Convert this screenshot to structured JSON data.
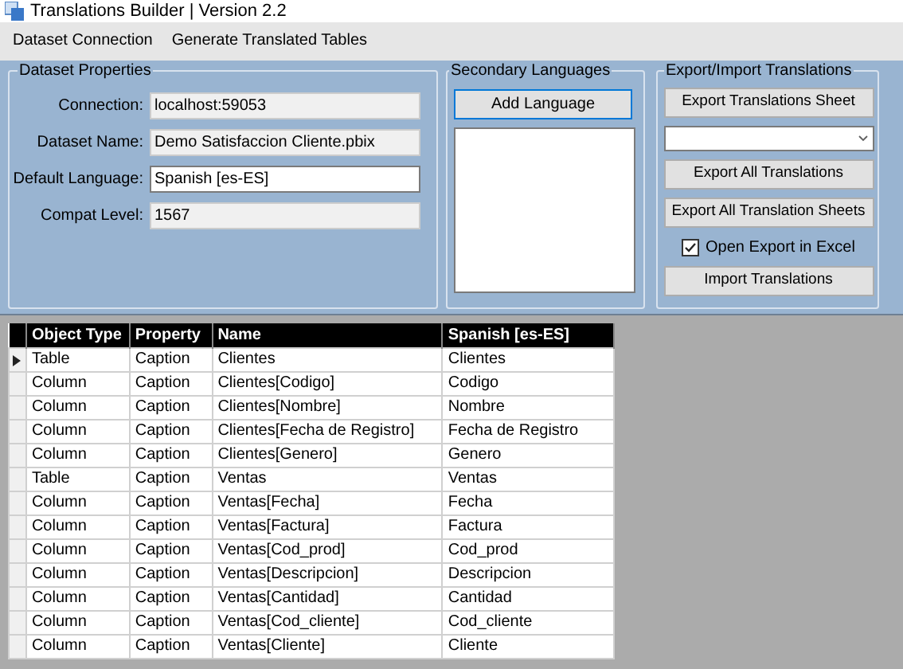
{
  "window": {
    "title": "Translations Builder | Version 2.2"
  },
  "menu": [
    "Dataset Connection",
    "Generate Translated Tables"
  ],
  "dataset_properties": {
    "title": "Dataset Properties",
    "fields": [
      {
        "label": "Connection:",
        "value": "localhost:59053",
        "disabled": true
      },
      {
        "label": "Dataset Name:",
        "value": "Demo Satisfaccion Cliente.pbix",
        "disabled": true
      },
      {
        "label": "Default Language:",
        "value": "Spanish [es-ES]",
        "disabled": false
      },
      {
        "label": "Compat Level:",
        "value": "1567",
        "disabled": true
      }
    ]
  },
  "secondary_languages": {
    "title": "Secondary Languages",
    "button": "Add Language"
  },
  "export_import": {
    "title": "Export/Import Translations",
    "items": [
      {
        "kind": "button",
        "label": "Export Translations Sheet"
      },
      {
        "kind": "dropdown"
      },
      {
        "kind": "button",
        "label": "Export All Translations"
      },
      {
        "kind": "button",
        "label": "Export All Translation Sheets"
      },
      {
        "kind": "checkbox",
        "label": "Open Export in Excel",
        "checked": true
      },
      {
        "kind": "button",
        "label": "Import Translations"
      }
    ]
  },
  "table": {
    "columns": [
      "Object Type",
      "Property",
      "Name",
      "Spanish [es-ES]"
    ],
    "rows": [
      {
        "cells": [
          "Table",
          "Caption",
          "Clientes",
          "Clientes"
        ],
        "current": true
      },
      {
        "cells": [
          "Column",
          "Caption",
          "Clientes[Codigo]",
          "Codigo"
        ],
        "current": false
      },
      {
        "cells": [
          "Column",
          "Caption",
          "Clientes[Nombre]",
          "Nombre"
        ],
        "current": false
      },
      {
        "cells": [
          "Column",
          "Caption",
          "Clientes[Fecha de Registro]",
          "Fecha de Registro"
        ],
        "current": false
      },
      {
        "cells": [
          "Column",
          "Caption",
          "Clientes[Genero]",
          "Genero"
        ],
        "current": false
      },
      {
        "cells": [
          "Table",
          "Caption",
          "Ventas",
          "Ventas"
        ],
        "current": false
      },
      {
        "cells": [
          "Column",
          "Caption",
          "Ventas[Fecha]",
          "Fecha"
        ],
        "current": false
      },
      {
        "cells": [
          "Column",
          "Caption",
          "Ventas[Factura]",
          "Factura"
        ],
        "current": false
      },
      {
        "cells": [
          "Column",
          "Caption",
          "Ventas[Cod_prod]",
          "Cod_prod"
        ],
        "current": false
      },
      {
        "cells": [
          "Column",
          "Caption",
          "Ventas[Descripcion]",
          "Descripcion"
        ],
        "current": false
      },
      {
        "cells": [
          "Column",
          "Caption",
          "Ventas[Cantidad]",
          "Cantidad"
        ],
        "current": false
      },
      {
        "cells": [
          "Column",
          "Caption",
          "Ventas[Cod_cliente]",
          "Cod_cliente"
        ],
        "current": false
      },
      {
        "cells": [
          "Column",
          "Caption",
          "Ventas[Cliente]",
          "Cliente"
        ],
        "current": false
      }
    ]
  }
}
